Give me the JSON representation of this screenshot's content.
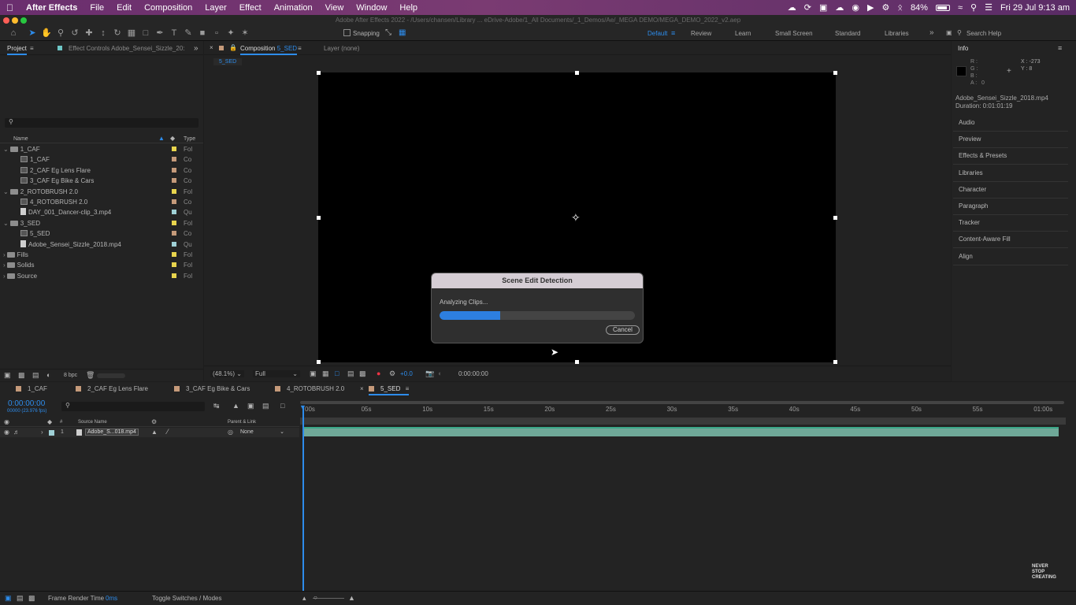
{
  "menubar": {
    "app_name": "After Effects",
    "items": [
      "File",
      "Edit",
      "Composition",
      "Layer",
      "Effect",
      "Animation",
      "View",
      "Window",
      "Help"
    ],
    "battery": "84%",
    "datetime": "Fri 29 Jul  9:13 am"
  },
  "window": {
    "title": "Adobe After Effects 2022 - /Users/chansen/Library ... eDrive-Adobe/1_All Documents/_1_Demos/Ae/_MEGA DEMO/MEGA_DEMO_2022_v2.aep"
  },
  "toolbar": {
    "snapping_label": "Snapping",
    "workspaces": [
      "Default",
      "Review",
      "Learn",
      "Small Screen",
      "Standard",
      "Libraries"
    ],
    "active_workspace": "Default",
    "search_placeholder": "Search Help"
  },
  "project_panel": {
    "tab_project": "Project",
    "tab_effect_controls": "Effect Controls Adobe_Sensei_Sizzle_20:",
    "col_name": "Name",
    "col_type": "Type",
    "rows": [
      {
        "name": "1_CAF",
        "type": "Fol",
        "kind": "folder",
        "level": 0,
        "color": "#e8d44d"
      },
      {
        "name": "1_CAF",
        "type": "Co",
        "kind": "comp",
        "level": 1,
        "color": "#c59a7a"
      },
      {
        "name": "2_CAF Eg Lens Flare",
        "type": "Co",
        "kind": "comp",
        "level": 1,
        "color": "#c59a7a"
      },
      {
        "name": "3_CAF Eg Bike & Cars",
        "type": "Co",
        "kind": "comp",
        "level": 1,
        "color": "#c59a7a"
      },
      {
        "name": "2_ROTOBRUSH 2.0",
        "type": "Fol",
        "kind": "folder",
        "level": 0,
        "color": "#e8d44d"
      },
      {
        "name": "4_ROTOBRUSH 2.0",
        "type": "Co",
        "kind": "comp",
        "level": 1,
        "color": "#c59a7a"
      },
      {
        "name": "DAY_001_Dancer-clip_3.mp4",
        "type": "Qu",
        "kind": "file",
        "level": 1,
        "color": "#9fd0d6"
      },
      {
        "name": "3_SED",
        "type": "Fol",
        "kind": "folder",
        "level": 0,
        "color": "#e8d44d"
      },
      {
        "name": "5_SED",
        "type": "Co",
        "kind": "comp",
        "level": 1,
        "color": "#c59a7a"
      },
      {
        "name": "Adobe_Sensei_Sizzle_2018.mp4",
        "type": "Qu",
        "kind": "file",
        "level": 1,
        "color": "#9fd0d6"
      },
      {
        "name": "Fills",
        "type": "Fol",
        "kind": "folder",
        "level": 0,
        "color": "#e8d44d"
      },
      {
        "name": "Solids",
        "type": "Fol",
        "kind": "folder",
        "level": 0,
        "color": "#e8d44d"
      },
      {
        "name": "Source",
        "type": "Fol",
        "kind": "folder",
        "level": 0,
        "color": "#e8d44d"
      }
    ],
    "bpc": "8 bpc"
  },
  "comp_panel": {
    "tab_composition": "Composition",
    "comp_name": "5_SED",
    "tab_layer": "Layer (none)",
    "breadcrumb": "5_SED",
    "zoom": "(48.1%)",
    "resolution": "Full",
    "exposure": "+0.0",
    "timecode": "0:00:00:00"
  },
  "dialog": {
    "title": "Scene Edit Detection",
    "status": "Analyzing Clips...",
    "progress": 0.31,
    "cancel_label": "Cancel"
  },
  "info_panel": {
    "title": "Info",
    "r_label": "R :",
    "g_label": "G :",
    "b_label": "B :",
    "a_label": "A :",
    "a_value": "0",
    "x_label": "X : -273",
    "y_label": "Y : 8",
    "file": "Adobe_Sensei_Sizzle_2018.mp4",
    "duration": "Duration: 0:01:01:19"
  },
  "right_panels": [
    "Audio",
    "Preview",
    "Effects & Presets",
    "Libraries",
    "Character",
    "Paragraph",
    "Tracker",
    "Content-Aware Fill",
    "Align"
  ],
  "timeline": {
    "tabs": [
      "1_CAF",
      "2_CAF Eg Lens Flare",
      "3_CAF Eg Bike & Cars",
      "4_ROTOBRUSH 2.0",
      "5_SED"
    ],
    "active_tab": "5_SED",
    "timecode": "0:00:00:00",
    "fps": "00000 (23.976 fps)",
    "col_num": "#",
    "col_source": "Source Name",
    "col_parent": "Parent & Link",
    "layer_num": "1",
    "layer_name": "Adobe_S...018.mp4",
    "parent_value": "None",
    "ruler_labels": [
      "00s",
      "05s",
      "10s",
      "15s",
      "20s",
      "25s",
      "30s",
      "35s",
      "40s",
      "45s",
      "50s",
      "55s",
      "01:00s"
    ],
    "footer_render": "Frame Render Time",
    "footer_render_value": "0ms",
    "footer_toggle": "Toggle Switches / Modes"
  },
  "watermark": [
    "NEVER",
    "STOP",
    "CREATING"
  ]
}
